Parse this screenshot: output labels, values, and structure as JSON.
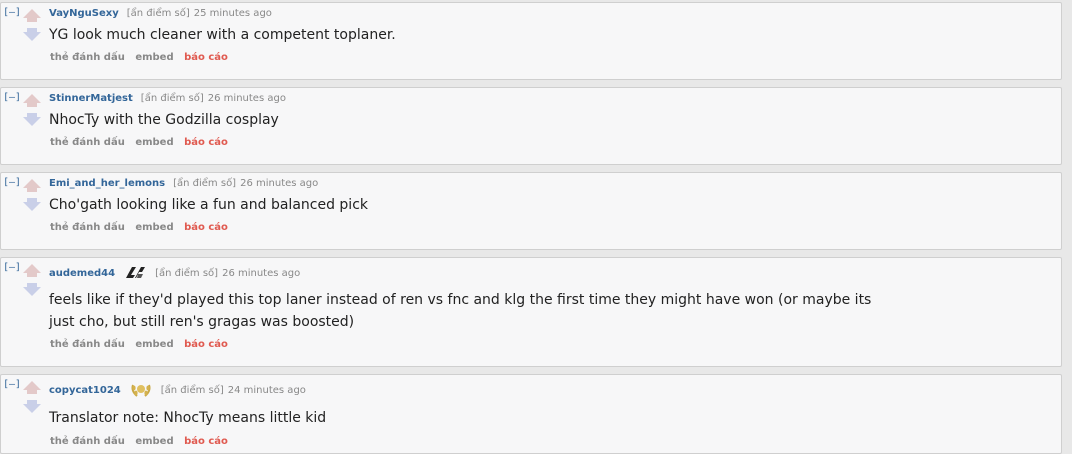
{
  "collapse_label": "[–]",
  "comments": [
    {
      "author": "VayNguSexy",
      "hidden_score": "[ẩn điểm số]",
      "time": "25 minutes ago",
      "text": "YG look much cleaner with a competent toplaner.",
      "actions": {
        "save": "thẻ đánh dấu",
        "embed": "embed",
        "report": "báo cáo"
      }
    },
    {
      "author": "StinnerMatjest",
      "hidden_score": "[ẩn điểm số]",
      "time": "26 minutes ago",
      "text": "NhocTy with the Godzilla cosplay",
      "actions": {
        "save": "thẻ đánh dấu",
        "embed": "embed",
        "report": "báo cáo"
      }
    },
    {
      "author": "Emi_and_her_lemons",
      "hidden_score": "[ẩn điểm số]",
      "time": "26 minutes ago",
      "text": "Cho'gath looking like a fun and balanced pick",
      "actions": {
        "save": "thẻ đánh dấu",
        "embed": "embed",
        "report": "báo cáo"
      }
    },
    {
      "author": "audemed44",
      "flair": "clg-logo-icon",
      "hidden_score": "[ẩn điểm số]",
      "time": "26 minutes ago",
      "text": "feels like if they'd played this top laner instead of ren vs fnc and klg the first time they might have won (or maybe its just cho, but still ren's gragas was boosted)",
      "actions": {
        "save": "thẻ đánh dấu",
        "embed": "embed",
        "report": "báo cáo"
      }
    },
    {
      "author": "copycat1024",
      "flair": "gold-wreath-icon",
      "hidden_score": "[ẩn điểm số]",
      "time": "24 minutes ago",
      "text": "Translator note: NhocTy means little kid",
      "actions": {
        "save": "thẻ đánh dấu",
        "embed": "embed",
        "report": "báo cáo"
      }
    }
  ]
}
